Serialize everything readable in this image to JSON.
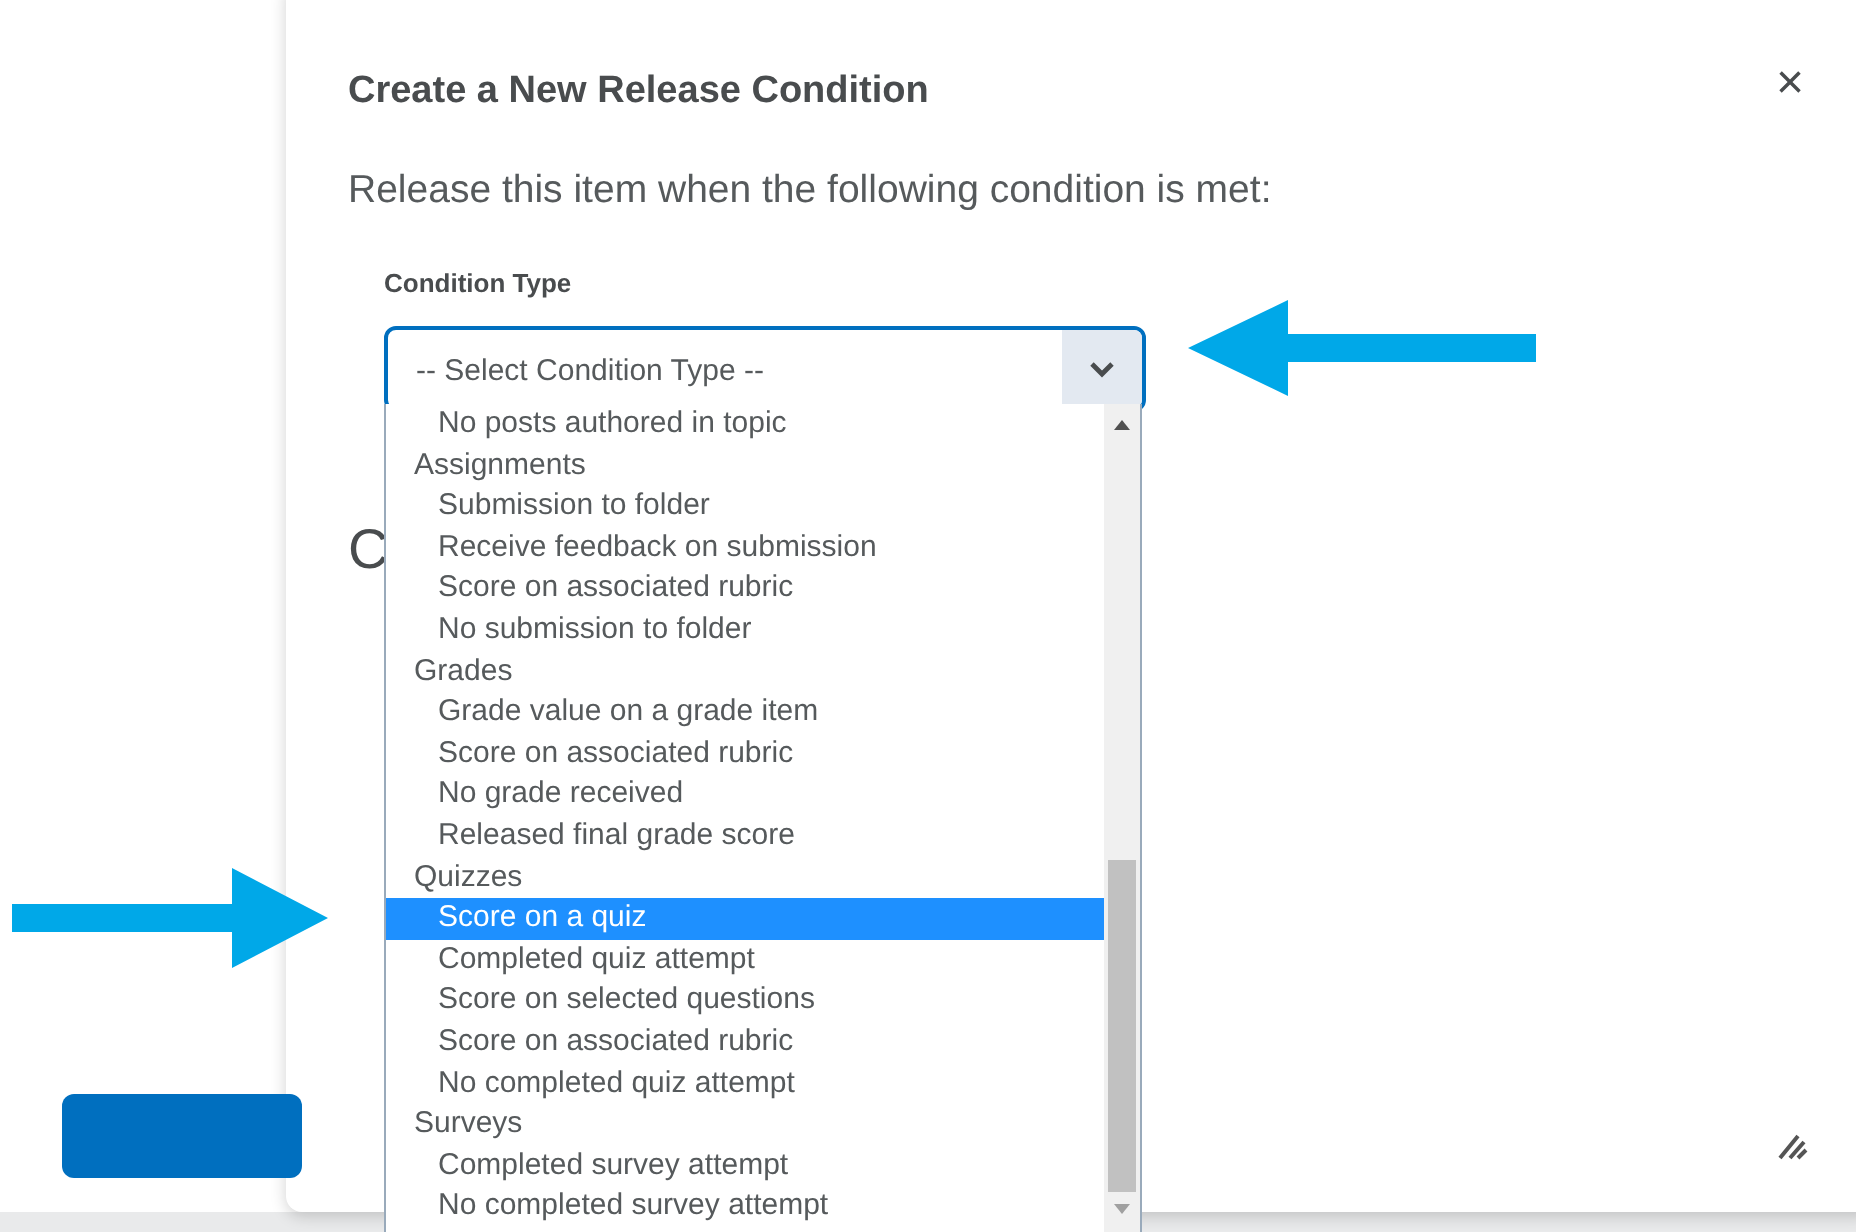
{
  "dialog": {
    "title": "Create a New Release Condition",
    "close": "×",
    "instruction": "Release this item when the following condition is met:",
    "field_label": "Condition Type",
    "select": {
      "value": "-- Select Condition Type --"
    },
    "hidden_heading": "C"
  },
  "dropdown": {
    "options": [
      {
        "kind": "option",
        "label": "No posts authored in topic",
        "selected": false
      },
      {
        "kind": "header",
        "label": "Assignments"
      },
      {
        "kind": "option",
        "label": "Submission to folder",
        "selected": false
      },
      {
        "kind": "option",
        "label": "Receive feedback on submission",
        "selected": false
      },
      {
        "kind": "option",
        "label": "Score on associated rubric",
        "selected": false
      },
      {
        "kind": "option",
        "label": "No submission to folder",
        "selected": false
      },
      {
        "kind": "header",
        "label": "Grades"
      },
      {
        "kind": "option",
        "label": "Grade value on a grade item",
        "selected": false
      },
      {
        "kind": "option",
        "label": "Score on associated rubric",
        "selected": false
      },
      {
        "kind": "option",
        "label": "No grade received",
        "selected": false
      },
      {
        "kind": "option",
        "label": "Released final grade score",
        "selected": false
      },
      {
        "kind": "header",
        "label": "Quizzes"
      },
      {
        "kind": "option",
        "label": "Score on a quiz",
        "selected": true
      },
      {
        "kind": "option",
        "label": "Completed quiz attempt",
        "selected": false
      },
      {
        "kind": "option",
        "label": "Score on selected questions",
        "selected": false
      },
      {
        "kind": "option",
        "label": "Score on associated rubric",
        "selected": false
      },
      {
        "kind": "option",
        "label": "No completed quiz attempt",
        "selected": false
      },
      {
        "kind": "header",
        "label": "Surveys"
      },
      {
        "kind": "option",
        "label": "Completed survey attempt",
        "selected": false
      },
      {
        "kind": "option",
        "label": "No completed survey attempt",
        "selected": false
      }
    ]
  }
}
